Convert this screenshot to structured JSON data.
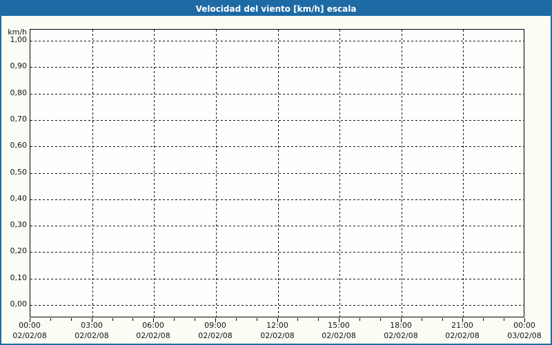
{
  "window": {
    "title": "Velocidad del viento [km/h] escala"
  },
  "theme": {
    "titlebar_bg": "#1d6aa4",
    "outer_border": "#1d6aa4",
    "page_bg": "#fbfdf5",
    "plot_bg": "#fefefc",
    "grid_color": "#111111",
    "text_color": "#111111",
    "title_text_color": "#ffffff"
  },
  "chart_data": {
    "type": "line",
    "title": "Velocidad del viento [km/h] escala",
    "unit_label": "km/h",
    "ylabel": "km/h",
    "ylim": [
      0.0,
      1.0
    ],
    "grid": true,
    "grid_style": "dashed",
    "y_ticks": [
      {
        "value": 1.0,
        "label": "1,00"
      },
      {
        "value": 0.9,
        "label": "0,90"
      },
      {
        "value": 0.8,
        "label": "0,80"
      },
      {
        "value": 0.7,
        "label": "0,70"
      },
      {
        "value": 0.6,
        "label": "0,60"
      },
      {
        "value": 0.5,
        "label": "0,50"
      },
      {
        "value": 0.4,
        "label": "0,40"
      },
      {
        "value": 0.3,
        "label": "0,30"
      },
      {
        "value": 0.2,
        "label": "0,20"
      },
      {
        "value": 0.1,
        "label": "0,10"
      },
      {
        "value": 0.0,
        "label": "0,00"
      }
    ],
    "x_ticks": [
      {
        "time": "00:00",
        "date": "02/02/08"
      },
      {
        "time": "03:00",
        "date": "02/02/08"
      },
      {
        "time": "06:00",
        "date": "02/02/08"
      },
      {
        "time": "09:00",
        "date": "02/02/08"
      },
      {
        "time": "12:00",
        "date": "02/02/08"
      },
      {
        "time": "15:00",
        "date": "02/02/08"
      },
      {
        "time": "18:00",
        "date": "02/02/08"
      },
      {
        "time": "21:00",
        "date": "02/02/08"
      },
      {
        "time": "00:00",
        "date": "03/02/08"
      }
    ],
    "x_minor_ticks_per_major_interval": 3,
    "series": []
  }
}
